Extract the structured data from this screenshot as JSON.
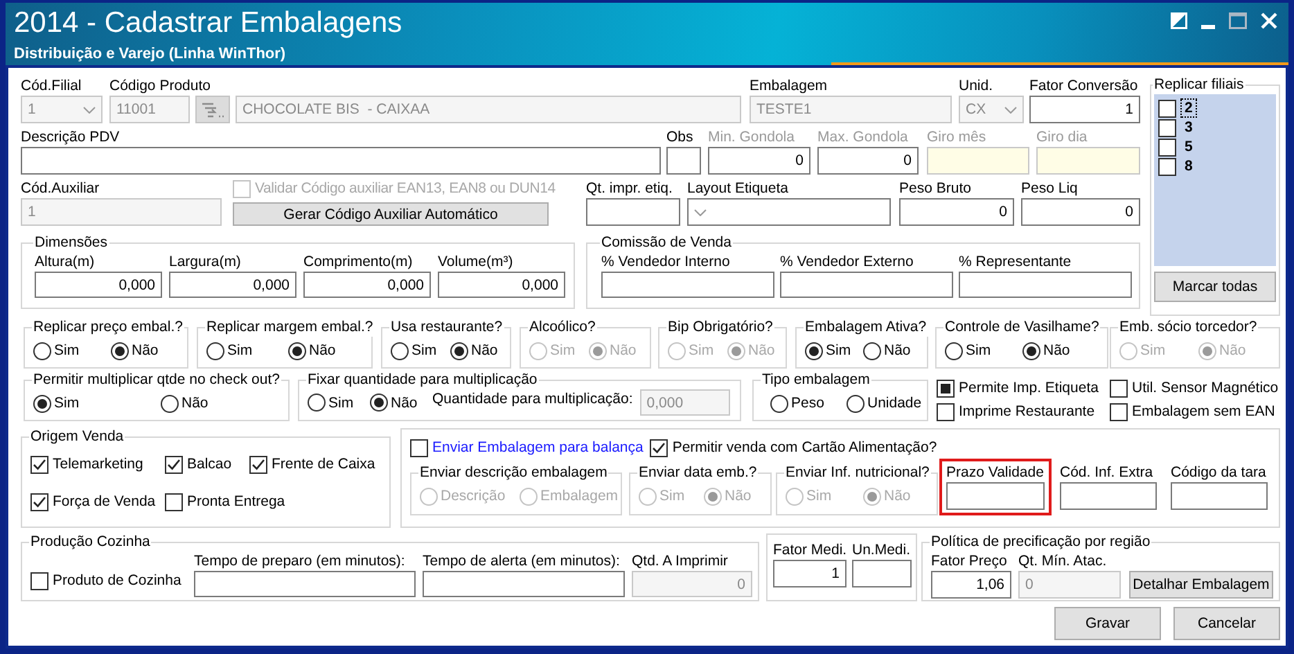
{
  "window": {
    "title": "2014 - Cadastrar Embalagens",
    "subtitle": "Distribuição e Varejo (Linha WinThor)"
  },
  "fields": {
    "cod_filial": {
      "label": "Cód.Filial",
      "value": "1",
      "disabled": true,
      "dropdown": true
    },
    "codigo_produto": {
      "label": "Código Produto",
      "value": "11001",
      "disabled": true
    },
    "descricao_produto": {
      "value": "CHOCOLATE BIS  - CAIXAA",
      "disabled": true
    },
    "embalagem": {
      "label": "Embalagem",
      "value": "TESTE1",
      "disabled": true
    },
    "unid": {
      "label": "Unid.",
      "value": "CX",
      "disabled": true,
      "dropdown": true
    },
    "fator_conversao": {
      "label": "Fator Conversão",
      "value": "1"
    },
    "descricao_pdv": {
      "label": "Descrição PDV"
    },
    "obs": {
      "label": "Obs"
    },
    "min_gondola": {
      "label": "Min. Gondola",
      "value": "0",
      "label_disabled": true
    },
    "max_gondola": {
      "label": "Max. Gondola",
      "value": "0",
      "label_disabled": true
    },
    "giro_mes": {
      "label": "Giro mês",
      "label_disabled": true,
      "readonly": true
    },
    "giro_dia": {
      "label": "Giro dia",
      "label_disabled": true,
      "readonly": true
    },
    "cod_auxiliar": {
      "label": "Cód.Auxiliar",
      "value": "1",
      "disabled": true
    },
    "qt_impr_etiq": {
      "label": "Qt. impr. etiq."
    },
    "layout_etiqueta": {
      "label": "Layout Etiqueta",
      "dropdown": true
    },
    "peso_bruto": {
      "label": "Peso Bruto",
      "value": "0"
    },
    "peso_liq": {
      "label": "Peso Liq",
      "value": "0"
    }
  },
  "validar_auxiliar": {
    "label": "Validar Código auxiliar EAN13, EAN8 ou DUN14",
    "checked": false,
    "disabled": true
  },
  "gerar_button": "Gerar Código Auxiliar Automático",
  "dimensoes": {
    "title": "Dimensões",
    "fields": [
      {
        "label": "Altura(m)",
        "value": "0,000"
      },
      {
        "label": "Largura(m)",
        "value": "0,000"
      },
      {
        "label": "Comprimento(m)",
        "value": "0,000"
      },
      {
        "label": "Volume(m³)",
        "value": "0,000"
      }
    ]
  },
  "comissao": {
    "title": "Comissão de Venda",
    "fields": [
      {
        "label": "% Vendedor Interno"
      },
      {
        "label": "% Vendedor Externo"
      },
      {
        "label": "% Representante"
      }
    ]
  },
  "replicar_filiais": {
    "title": "Replicar filiais",
    "items": [
      {
        "label": "2",
        "checked": false,
        "focused": true
      },
      {
        "label": "3",
        "checked": false,
        "focused": false
      },
      {
        "label": "5",
        "checked": false,
        "focused": false
      },
      {
        "label": "8",
        "checked": false,
        "focused": false
      }
    ],
    "button": "Marcar todas"
  },
  "options_row": [
    {
      "title": "Replicar preço embal.?",
      "disabled": false,
      "options": [
        {
          "label": "Sim",
          "selected": false
        },
        {
          "label": "Não",
          "selected": true
        }
      ]
    },
    {
      "title": "Replicar margem embal.?",
      "disabled": false,
      "options": [
        {
          "label": "Sim",
          "selected": false
        },
        {
          "label": "Não",
          "selected": true
        }
      ]
    },
    {
      "title": "Usa restaurante?",
      "disabled": false,
      "options": [
        {
          "label": "Sim",
          "selected": false
        },
        {
          "label": "Não",
          "selected": true
        }
      ]
    },
    {
      "title": "Alcoólico?",
      "disabled": true,
      "options": [
        {
          "label": "Sim",
          "selected": false
        },
        {
          "label": "Não",
          "selected": true
        }
      ]
    },
    {
      "title": "Bip Obrigatório?",
      "disabled": true,
      "options": [
        {
          "label": "Sim",
          "selected": false
        },
        {
          "label": "Não",
          "selected": true
        }
      ]
    },
    {
      "title": "Embalagem Ativa?",
      "disabled": false,
      "options": [
        {
          "label": "Sim",
          "selected": true
        },
        {
          "label": "Não",
          "selected": false
        }
      ]
    },
    {
      "title": "Controle de Vasilhame?",
      "disabled": false,
      "options": [
        {
          "label": "Sim",
          "selected": false
        },
        {
          "label": "Não",
          "selected": true
        }
      ]
    },
    {
      "title": "Emb. sócio torcedor?",
      "disabled": true,
      "options": [
        {
          "label": "Sim",
          "selected": false
        },
        {
          "label": "Não",
          "selected": true
        }
      ]
    }
  ],
  "multiplicacao": {
    "title": "Permitir multiplicar qtde no check out?",
    "disabled": false,
    "options": [
      {
        "label": "Sim",
        "selected": true
      },
      {
        "label": "Não",
        "selected": false
      }
    ]
  },
  "fixar": {
    "title": "Fixar quantidade para multiplicação",
    "disabled": false,
    "options": [
      {
        "label": "Sim",
        "selected": false
      },
      {
        "label": "Não",
        "selected": true
      }
    ],
    "quantity": {
      "label": "Quantidade para multiplicação:",
      "value": "0,000",
      "disabled": true
    }
  },
  "tipo_embalagem": {
    "title": "Tipo embalagem",
    "disabled": false,
    "options": [
      {
        "label": "Peso",
        "selected": false
      },
      {
        "label": "Unidade",
        "selected": false
      }
    ]
  },
  "flags": [
    {
      "label": "Permite Imp. Etiqueta",
      "indeterminate": true
    },
    {
      "label": "Util. Sensor Magnético",
      "checked": false
    },
    {
      "label": "Imprime Restaurante",
      "checked": false
    },
    {
      "label": "Embalagem sem EAN",
      "checked": false
    }
  ],
  "origem_venda": {
    "title": "Origem Venda",
    "items": [
      {
        "label": "Telemarketing",
        "checked": true
      },
      {
        "label": "Balcao",
        "checked": true
      },
      {
        "label": "Frente de Caixa",
        "checked": true
      },
      {
        "label": "Força de Venda",
        "checked": true
      },
      {
        "label": "Pronta Entrega",
        "checked": false
      }
    ]
  },
  "balanca": {
    "enviar": {
      "label": "Enviar Embalagem para balança",
      "checked": false
    },
    "cartao": {
      "label": "Permitir venda com Cartão Alimentação?",
      "checked": true
    },
    "groups": [
      {
        "title": "Enviar descrição embalagem",
        "disabled": true,
        "options": [
          {
            "label": "Descrição",
            "selected": false
          },
          {
            "label": "Embalagem",
            "selected": false
          }
        ]
      },
      {
        "title": "Enviar data emb.?",
        "disabled": true,
        "options": [
          {
            "label": "Sim",
            "selected": false
          },
          {
            "label": "Não",
            "selected": true
          }
        ]
      },
      {
        "title": "Enviar Inf. nutricional?",
        "disabled": true,
        "options": [
          {
            "label": "Sim",
            "selected": false
          },
          {
            "label": "Não",
            "selected": true
          }
        ]
      }
    ],
    "fields": [
      {
        "label": "Prazo Validade",
        "highlighted": true
      },
      {
        "label": "Cód. Inf. Extra"
      },
      {
        "label": "Código da tara"
      }
    ]
  },
  "producao": {
    "title": "Produção Cozinha",
    "produto_cozinha": {
      "label": "Produto de Cozinha",
      "checked": false
    },
    "fields": [
      {
        "label": "Tempo de preparo (em minutos):"
      },
      {
        "label": "Tempo de alerta (em minutos):"
      },
      {
        "label": "Qtd. A Imprimir",
        "value": "0",
        "disabled": true
      }
    ]
  },
  "medida": {
    "fields": [
      {
        "label": "Fator Medi.",
        "value": "1"
      },
      {
        "label": "Un.Medi."
      }
    ]
  },
  "politica": {
    "title": "Política de precificação por região",
    "fields": [
      {
        "label": "Fator Preço",
        "value": "1,06"
      },
      {
        "label": "Qt. Mín. Atac.",
        "value": "0",
        "disabled": true
      }
    ],
    "button": "Detalhar Embalagem"
  },
  "buttons": [
    "Gravar",
    "Cancelar"
  ]
}
